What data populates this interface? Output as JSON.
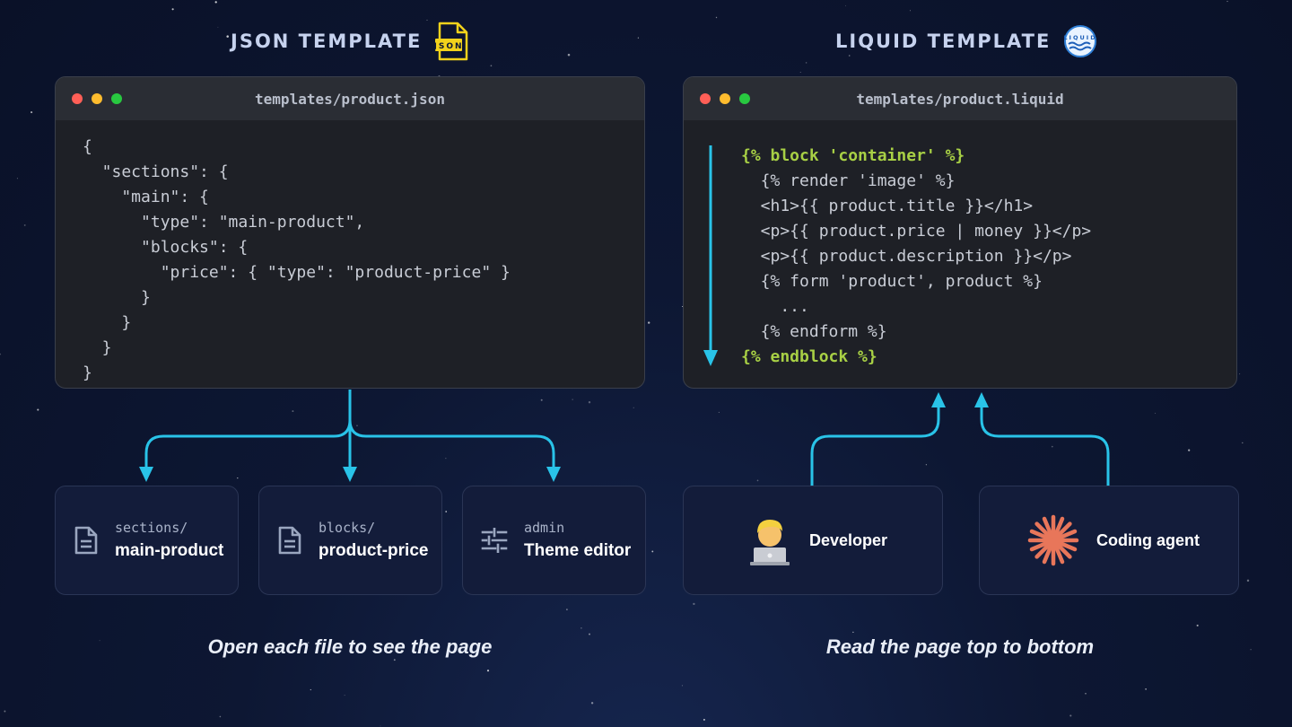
{
  "headings": {
    "json": "JSON TEMPLATE",
    "json_badge": "JSON",
    "liquid": "LIQUID TEMPLATE",
    "liquid_badge": "LIQUID"
  },
  "json_window": {
    "filename": "templates/product.json",
    "code": "{\n  \"sections\": {\n    \"main\": {\n      \"type\": \"main-product\",\n      \"blocks\": {\n        \"price\": { \"type\": \"product-price\" }\n      }\n    }\n  }\n}"
  },
  "liquid_window": {
    "filename": "templates/product.liquid",
    "lines": [
      {
        "text": "{% block 'container' %}",
        "highlight": true
      },
      {
        "text": "  {% render 'image' %}",
        "highlight": false
      },
      {
        "text": "  <h1>{{ product.title }}</h1>",
        "highlight": false
      },
      {
        "text": "  <p>{{ product.price | money }}</p>",
        "highlight": false
      },
      {
        "text": "  <p>{{ product.description }}</p>",
        "highlight": false
      },
      {
        "text": "  {% form 'product', product %}",
        "highlight": false
      },
      {
        "text": "    ...",
        "highlight": false
      },
      {
        "text": "  {% endform %}",
        "highlight": false
      },
      {
        "text": "{% endblock %}",
        "highlight": true
      }
    ]
  },
  "cards": {
    "sections": {
      "small": "sections/",
      "big": "main-product",
      "icon": "file-icon"
    },
    "blocks": {
      "small": "blocks/",
      "big": "product-price",
      "icon": "file-icon"
    },
    "admin": {
      "small": "admin",
      "big": "Theme editor",
      "icon": "sliders-icon"
    },
    "developer": {
      "label": "Developer",
      "icon": "developer-emoji-icon"
    },
    "agent": {
      "label": "Coding agent",
      "icon": "starburst-icon"
    }
  },
  "captions": {
    "left": "Open each file to see the page",
    "right": "Read the page top to bottom"
  },
  "colors": {
    "arrow": "#29c3e8",
    "liquid_keyword": "#a8d045",
    "json_badge": "#f2d21b",
    "dot_red": "#ff5f57",
    "dot_yellow": "#febc2e",
    "dot_green": "#28c840",
    "agent_accent": "#e8765a"
  }
}
